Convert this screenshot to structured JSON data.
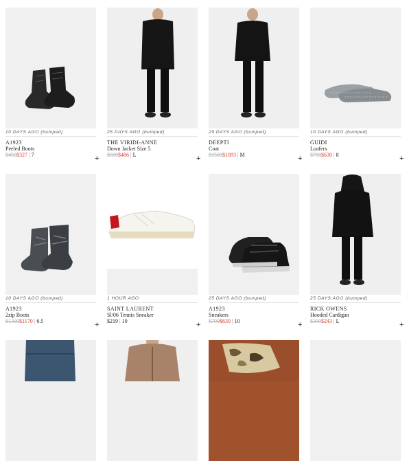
{
  "items": [
    {
      "time": "10 DAYS AGO (bumped)",
      "designer": "A1923",
      "title": "Peeled Boots",
      "old_price": "$450",
      "price": "$327",
      "size": "7",
      "add": "+"
    },
    {
      "time": "25 DAYS AGO (bumped)",
      "designer": "THE VIRIDI-ANNE",
      "title": "Down Jacket Size 5",
      "old_price": "$600",
      "price": "$486",
      "size": "L",
      "add": "+"
    },
    {
      "time": "29 DAYS AGO (bumped)",
      "designer": "DEEPTI",
      "title": "Coat",
      "old_price": "$1500",
      "price": "$1093",
      "size": "M",
      "add": "+"
    },
    {
      "time": "10 DAYS AGO (bumped)",
      "designer": "GUIDI",
      "title": "Loafers",
      "old_price": "$700",
      "price": "$630",
      "size": "8",
      "add": "+"
    },
    {
      "time": "10 DAYS AGO (bumped)",
      "designer": "A1923",
      "title": "2zip Boots",
      "old_price": "$1300",
      "price": "$1170",
      "size": "6.5",
      "add": "+"
    },
    {
      "time": "1 HOUR AGO",
      "designer": "SAINT LAURENT",
      "title": "Sl/06 Tennis Sneaker",
      "old_price": "",
      "price": "$219",
      "size": "10",
      "add": "+"
    },
    {
      "time": "25 DAYS AGO (bumped)",
      "designer": "A1923",
      "title": "Sneakers",
      "old_price": "$700",
      "price": "$630",
      "size": "10",
      "add": "+"
    },
    {
      "time": "25 DAYS AGO (bumped)",
      "designer": "RICK OWENS",
      "title": "Hooded Cardigan",
      "old_price": "$300",
      "price": "$243",
      "size": "L",
      "add": "+"
    }
  ]
}
